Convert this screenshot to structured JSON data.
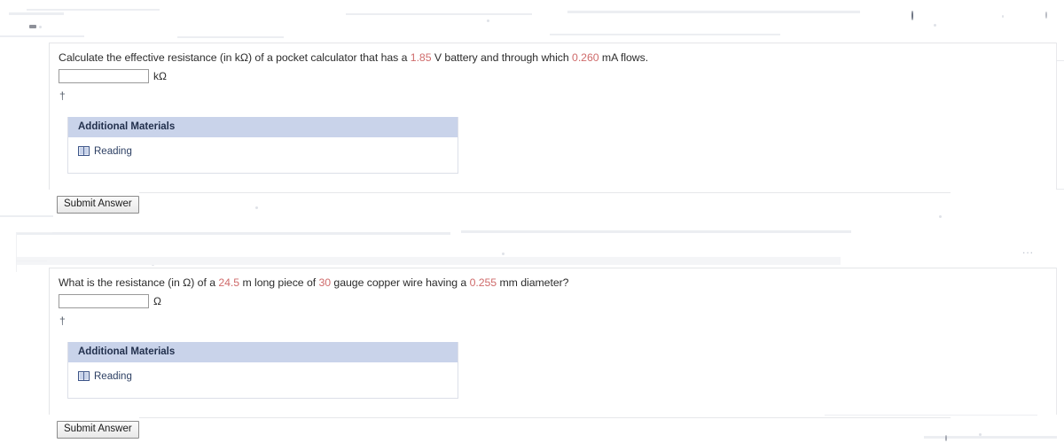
{
  "page": {
    "background_color": "#ffffff",
    "accent_number_color": "#cf6b6b",
    "materials_header_color": "#c9d3ea",
    "link_color": "#2c3f63"
  },
  "questions": [
    {
      "id": "question-1",
      "prompt_parts": [
        {
          "text": "Calculate the effective resistance (in kΩ) of a pocket calculator that has a ",
          "highlight": false
        },
        {
          "text": "1.85",
          "highlight": true
        },
        {
          "text": " V battery and through which ",
          "highlight": false
        },
        {
          "text": "0.260",
          "highlight": true
        },
        {
          "text": " mA flows.",
          "highlight": false
        }
      ],
      "answer": {
        "value": "",
        "placeholder": "",
        "unit": "kΩ"
      },
      "footnote_symbol": "†",
      "materials": {
        "header": "Additional Materials",
        "items": [
          {
            "label": "Reading",
            "icon": "book-icon"
          }
        ]
      },
      "submit_label": "Submit Answer"
    },
    {
      "id": "question-2",
      "prompt_parts": [
        {
          "text": "What is the resistance (in Ω) of a ",
          "highlight": false
        },
        {
          "text": "24.5",
          "highlight": true
        },
        {
          "text": " m long piece of ",
          "highlight": false
        },
        {
          "text": "30",
          "highlight": true
        },
        {
          "text": " gauge copper wire having a ",
          "highlight": false
        },
        {
          "text": "0.255",
          "highlight": true
        },
        {
          "text": " mm diameter?",
          "highlight": false
        }
      ],
      "answer": {
        "value": "",
        "placeholder": "",
        "unit": "Ω"
      },
      "footnote_symbol": "†",
      "materials": {
        "header": "Additional Materials",
        "items": [
          {
            "label": "Reading",
            "icon": "book-icon"
          }
        ]
      },
      "submit_label": "Submit Answer"
    }
  ],
  "decorations": {
    "ellipsis": "..."
  }
}
